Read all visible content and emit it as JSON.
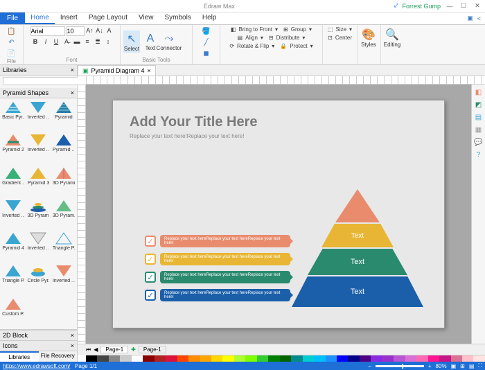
{
  "app_name": "Edraw Max",
  "user": "Forrest Gump",
  "window": {
    "minimize": "—",
    "maximize": "☐",
    "close": "✕"
  },
  "menu": {
    "file": "File",
    "tabs": [
      "Home",
      "Insert",
      "Page Layout",
      "View",
      "Symbols",
      "Help"
    ],
    "active": 0
  },
  "ribbon": {
    "file_group": "File",
    "font_group": "Font",
    "font_name": "Arial",
    "font_size": "10",
    "basic_tools": "Basic Tools",
    "select": "Select",
    "text": "Text",
    "connector": "Connector",
    "arrange": {
      "bring_front": "Bring to Front",
      "align": "Align",
      "rotate": "Rotate & Flip",
      "group": "Group",
      "distribute": "Distribute",
      "size": "Size",
      "center": "Center",
      "protect": "Protect"
    },
    "styles": "Styles",
    "editing": "Editing"
  },
  "sidebar": {
    "header": "Libraries",
    "search_placeholder": "",
    "shapes_header": "Pyramid Shapes",
    "shapes": [
      "Basic Pyr...",
      "Inverted ...",
      "Pyramid",
      "Pyramid 2",
      "Inverted ...",
      "Pyramid ...",
      "Gradient ...",
      "Pyramid 3",
      "3D Pyramid",
      "Inverted ...",
      "3D Pyram...",
      "3D Pyram...",
      "Pyramid 4",
      "Inverted ...",
      "Triangle P...",
      "Triangle P...",
      "Circle Pyr...",
      "Inverted ...",
      "Custom P..."
    ],
    "footers": [
      "2D Block",
      "Icons"
    ],
    "tabs": [
      "Libraries",
      "File Recovery"
    ]
  },
  "document": {
    "tab": "Pyramid Diagram 4",
    "title": "Add Your Title Here",
    "subtitle": "Replace your text here!Replace your text here!",
    "pyramid_labels": [
      "",
      "Text",
      "Text",
      "Text"
    ],
    "callout_text": "Replace your text hereReplace your text hereReplace your text here!",
    "page_tabs": [
      "Page-1",
      "Page-1"
    ]
  },
  "status": {
    "url": "https://www.edrawsoft.com/",
    "page": "Page 1/1",
    "zoom": "80%"
  }
}
